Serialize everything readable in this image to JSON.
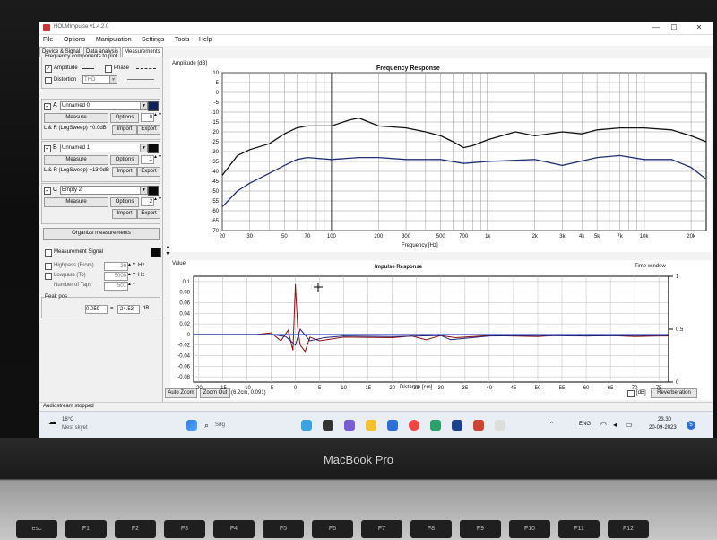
{
  "window": {
    "title": "HOLMImpulse v1.4.2.0",
    "min": "—",
    "max": "☐",
    "close": "✕"
  },
  "menu": [
    "File",
    "Options",
    "Manipulation",
    "Settings",
    "Tools",
    "Help"
  ],
  "tabs": [
    "Device & Signal",
    "Data analysis",
    "Measurements"
  ],
  "panel": {
    "freq_group": "Frequency components to plot",
    "amplitude": "Amplitude",
    "phase": "Phase",
    "distortion": "Distortion",
    "thd": "THD",
    "measure": "Measure",
    "options": "Options",
    "import": "Import",
    "export": "Export",
    "slots": [
      {
        "letter": "A",
        "name": "Unnamed 0",
        "count": "0",
        "info": "L & R (LogSweep) +0.0dB",
        "color": "#10205a",
        "checked": true
      },
      {
        "letter": "B",
        "name": "Unnamed 1",
        "count": "1",
        "info": "L & R (LogSweep) +13.0dB",
        "color": "#0a0a0a",
        "checked": true
      },
      {
        "letter": "C",
        "name": "Empty 2",
        "count": "2",
        "info": "",
        "color": "#0a0a0a",
        "checked": true
      }
    ],
    "organize": "Organize measurements",
    "meas_signal": "Measurement Signal",
    "highpass": "Highpass (From)",
    "highpass_val": "20",
    "hz1": "Hz",
    "lowpass": "Lowpass (To)",
    "lowpass_val": "5000",
    "hz2": "Hz",
    "taps": "Number of Taps",
    "taps_val": "501",
    "peak_group": "Peak pos",
    "peak_val": "0.059",
    "eq": "=",
    "peak_db": "-24.53",
    "db": "dB"
  },
  "freq_plot": {
    "title": "Frequency Response",
    "ylabel": "Amplitude [dB]",
    "xlabel": "Frequency [Hz]",
    "yticks": [
      "10",
      "5",
      "0",
      "-5",
      "-10",
      "-15",
      "-20",
      "-25",
      "-30",
      "-35",
      "-40",
      "-45",
      "-50",
      "-55",
      "-60",
      "-65",
      "-70"
    ],
    "xticks": [
      "20",
      "30",
      "50",
      "70",
      "100",
      "200",
      "300",
      "500",
      "700",
      "1k",
      "2k",
      "3k",
      "4k",
      "5k",
      "7k",
      "10k",
      "20k"
    ]
  },
  "imp_plot": {
    "title": "Impulse Response",
    "ylabel": "Value",
    "xlabel": "Distance [cm]",
    "right_label": "Time window",
    "yticks": [
      "0.1",
      "0.08",
      "0.06",
      "0.04",
      "0.02",
      "0",
      "-0.02",
      "-0.04",
      "-0.06",
      "-0.08"
    ],
    "xticks": [
      "-20",
      "-15",
      "-10",
      "-5",
      "0",
      "5",
      "10",
      "15",
      "20",
      "25",
      "30",
      "35",
      "40",
      "45",
      "50",
      "55",
      "60",
      "65",
      "70",
      "75"
    ],
    "rticks": [
      "1",
      "0.5",
      "0"
    ],
    "auto_zoom": "Auto Zoom",
    "zoom_out": "Zoom Out",
    "coords": "(6.2cm, 0.091)",
    "idb": "[dB]",
    "reverb": "Reverberation"
  },
  "status": "Audiostream stopped",
  "taskbar": {
    "weather_temp": "18°C",
    "weather_text": "Mest skyet",
    "search": "Søg",
    "lang": "ENG",
    "time": "23.30",
    "date": "20-09-2023"
  },
  "laptop": {
    "brand": "MacBook Pro",
    "fkeys": [
      "esc",
      "F1",
      "F2",
      "F3",
      "F4",
      "F5",
      "F6",
      "F7",
      "F8",
      "F9",
      "F10",
      "F11",
      "F12"
    ]
  },
  "chart_data": [
    {
      "type": "line",
      "title": "Frequency Response",
      "xlabel": "Frequency [Hz]",
      "ylabel": "Amplitude [dB]",
      "xscale": "log",
      "xlim": [
        20,
        25000
      ],
      "ylim": [
        -70,
        10
      ],
      "series": [
        {
          "x": [
            20,
            25,
            30,
            40,
            50,
            60,
            70,
            100,
            130,
            150,
            200,
            300,
            400,
            500,
            600,
            700,
            800,
            1000,
            1500,
            2000,
            3000,
            4000,
            5000,
            7000,
            10000,
            15000,
            20000,
            25000
          ],
          "y": [
            -42,
            -32,
            -29,
            -26,
            -21,
            -18,
            -17,
            -17,
            -14,
            -13,
            -17,
            -18,
            -20,
            -22,
            -25,
            -28,
            -27,
            -24,
            -20,
            -22,
            -20,
            -21,
            -19,
            -18,
            -18,
            -19,
            -22,
            -25
          ],
          "color": "#111111"
        },
        {
          "x": [
            20,
            25,
            30,
            40,
            50,
            60,
            70,
            100,
            150,
            200,
            300,
            500,
            700,
            1000,
            2000,
            3000,
            5000,
            7000,
            10000,
            15000,
            20000,
            25000
          ],
          "y": [
            -58,
            -50,
            -46,
            -41,
            -37,
            -34,
            -33,
            -34,
            -33,
            -33,
            -34,
            -34,
            -36,
            -35,
            -34,
            -37,
            -33,
            -32,
            -34,
            -34,
            -38,
            -44
          ],
          "color": "#203070"
        }
      ]
    },
    {
      "type": "line",
      "title": "Impulse Response",
      "xlabel": "Distance [cm]",
      "ylabel": "Value",
      "xlim": [
        -21,
        77
      ],
      "ylim": [
        -0.09,
        0.11
      ],
      "series": [
        {
          "x": [
            -21,
            -8,
            -5,
            -3,
            -1.5,
            -0.5,
            0,
            0.5,
            1,
            2,
            3,
            5,
            10,
            20,
            24,
            27,
            30,
            33,
            40,
            50,
            55,
            60,
            65,
            70,
            75,
            77
          ],
          "y": [
            0,
            0,
            0.003,
            -0.012,
            0.008,
            -0.03,
            0.095,
            0.01,
            -0.02,
            -0.032,
            -0.005,
            -0.012,
            -0.005,
            -0.006,
            -0.003,
            -0.01,
            -0.002,
            -0.006,
            -0.002,
            -0.004,
            -0.001,
            -0.003,
            -0.002,
            -0.004,
            -0.003,
            -0.003
          ],
          "color": "#8a1010"
        },
        {
          "x": [
            -21,
            -5,
            -2,
            0,
            1,
            3,
            6,
            10,
            20,
            30,
            32,
            40,
            50,
            60,
            70,
            77
          ],
          "y": [
            0,
            0,
            -0.004,
            -0.02,
            0.01,
            -0.012,
            -0.006,
            -0.003,
            -0.004,
            -0.002,
            -0.01,
            -0.003,
            -0.002,
            -0.003,
            -0.002,
            -0.002
          ],
          "color": "#202080"
        },
        {
          "x": [
            -21,
            77
          ],
          "y": [
            0,
            0
          ],
          "color": "#3050c0"
        }
      ]
    }
  ]
}
